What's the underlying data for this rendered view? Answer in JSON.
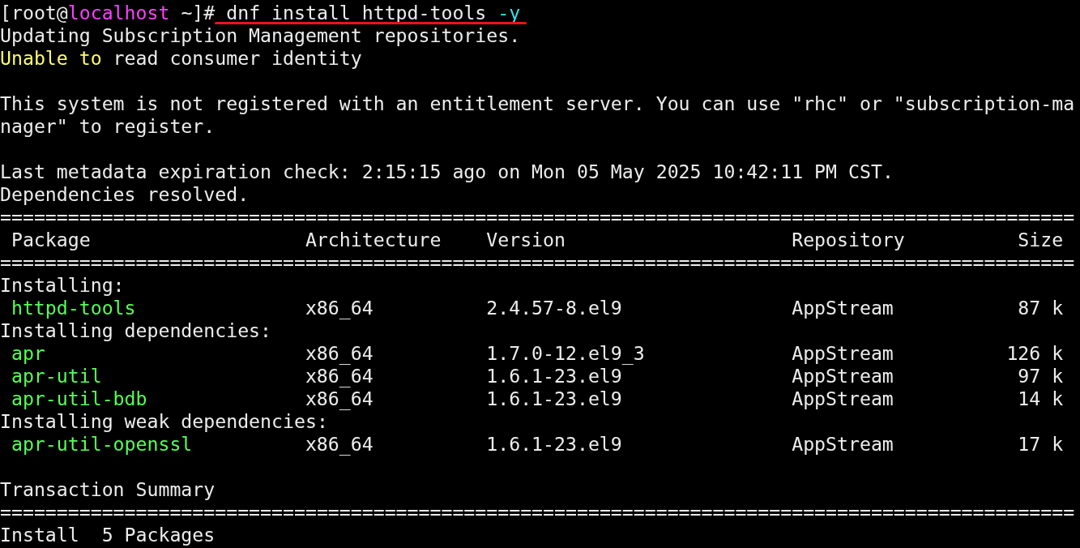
{
  "terminal": {
    "lines": [
      {
        "kind": "prompt",
        "user": "[root@",
        "host": "localhost",
        "path": "~]#",
        "command": "dnf install httpd-tools",
        "flag": "-y",
        "underlined": true
      },
      {
        "kind": "text",
        "text": "Updating Subscription Management repositories."
      },
      {
        "kind": "warning",
        "highlight": "Unable to",
        "text": "read consumer identity"
      },
      {
        "kind": "blank"
      },
      {
        "kind": "text",
        "text": "This system is not registered with an entitlement server. You can use \"rhc\" or \"subscription-ma"
      },
      {
        "kind": "text",
        "text": "nager\" to register."
      },
      {
        "kind": "blank"
      },
      {
        "kind": "text",
        "text": "Last metadata expiration check: 2:15:15 ago on Mon 05 May 2025 10:42:11 PM CST."
      },
      {
        "kind": "text",
        "text": "Dependencies resolved."
      },
      {
        "kind": "rule",
        "text": "==============================================================================================="
      },
      {
        "kind": "header",
        "columns": [
          "Package",
          "Architecture",
          "Version",
          "Repository",
          "Size"
        ]
      },
      {
        "kind": "rule",
        "text": "==============================================================================================="
      },
      {
        "kind": "group",
        "text": "Installing:"
      },
      {
        "kind": "package",
        "name": "httpd-tools",
        "arch": "x86_64",
        "version": "2.4.57-8.el9",
        "repo": "AppStream",
        "size": "87 k"
      },
      {
        "kind": "group",
        "text": "Installing dependencies:"
      },
      {
        "kind": "package",
        "name": "apr",
        "arch": "x86_64",
        "version": "1.7.0-12.el9_3",
        "repo": "AppStream",
        "size": "126 k"
      },
      {
        "kind": "package",
        "name": "apr-util",
        "arch": "x86_64",
        "version": "1.6.1-23.el9",
        "repo": "AppStream",
        "size": "97 k"
      },
      {
        "kind": "package",
        "name": "apr-util-bdb",
        "arch": "x86_64",
        "version": "1.6.1-23.el9",
        "repo": "AppStream",
        "size": "14 k"
      },
      {
        "kind": "group",
        "text": "Installing weak dependencies:"
      },
      {
        "kind": "package",
        "name": "apr-util-openssl",
        "arch": "x86_64",
        "version": "1.6.1-23.el9",
        "repo": "AppStream",
        "size": "17 k"
      },
      {
        "kind": "blank"
      },
      {
        "kind": "text",
        "text": "Transaction Summary"
      },
      {
        "kind": "rule",
        "text": "==============================================================================================="
      },
      {
        "kind": "text",
        "text": "Install  5 Packages"
      }
    ]
  }
}
